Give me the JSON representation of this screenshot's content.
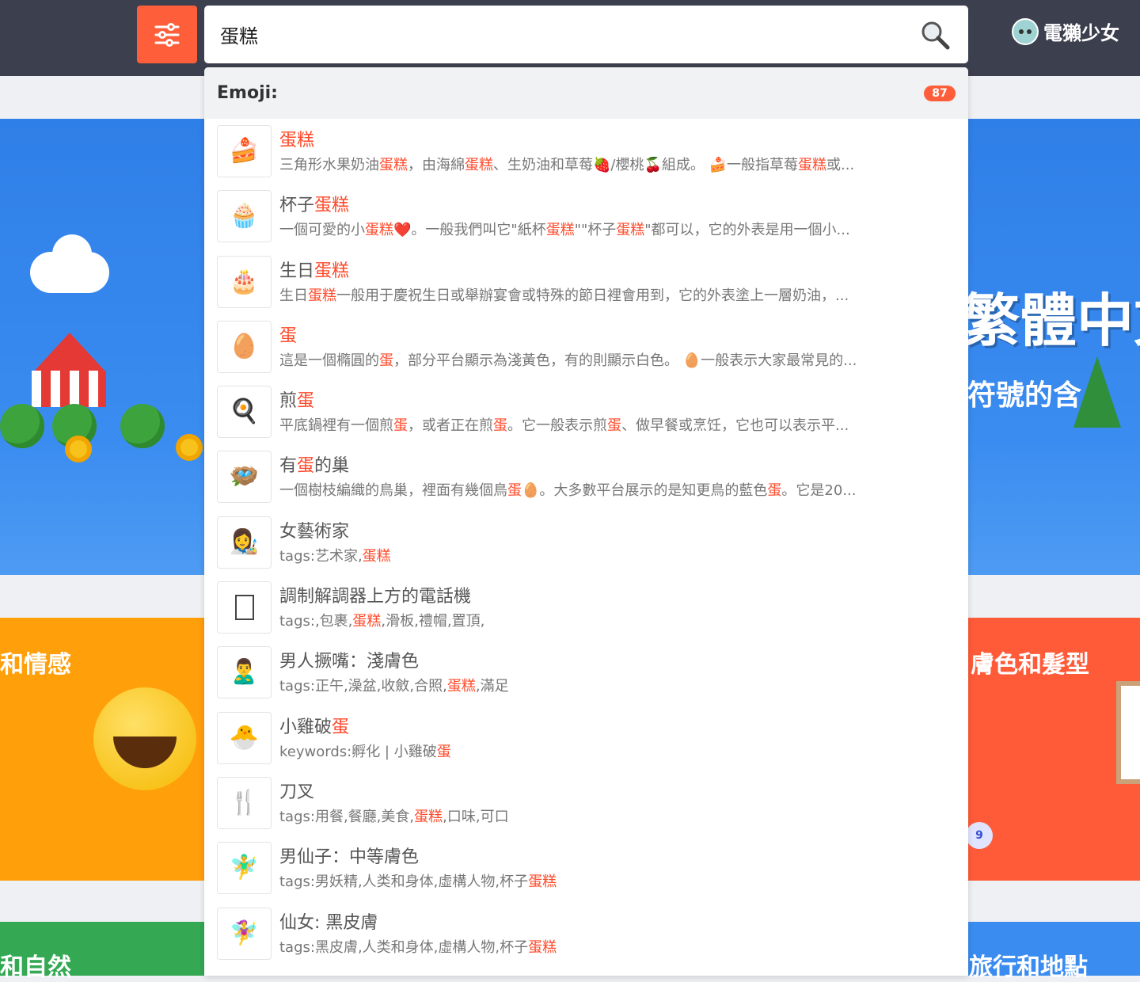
{
  "header": {
    "search_value": "蛋糕",
    "logo_text": "電獺少女"
  },
  "background": {
    "banner_text_1": "繁體中文",
    "banner_text_2": "符號的含",
    "left_card_1": "和情感",
    "right_card_1": "膚色和髮型",
    "left_card_2": "和自然",
    "right_card_2": "旅行和地點",
    "page_badge": "9"
  },
  "dropdown": {
    "section_title": "Emoji:",
    "count": "87",
    "items": [
      {
        "icon": "shortcake-icon",
        "title": [
          {
            "t": "蛋糕",
            "h": true
          }
        ],
        "desc": [
          {
            "t": "三角形水果奶油"
          },
          {
            "t": "蛋糕",
            "h": true
          },
          {
            "t": "，由海綿"
          },
          {
            "t": "蛋糕",
            "h": true
          },
          {
            "t": "、生奶油和草莓🍓/櫻桃🍒組成。 🍰一般指草莓"
          },
          {
            "t": "蛋糕",
            "h": true
          },
          {
            "t": "或..."
          }
        ]
      },
      {
        "icon": "cupcake-icon",
        "title": [
          {
            "t": "杯子"
          },
          {
            "t": "蛋糕",
            "h": true
          }
        ],
        "desc": [
          {
            "t": "一個可愛的小"
          },
          {
            "t": "蛋糕",
            "h": true
          },
          {
            "t": "❤️。一般我們叫它\"紙杯"
          },
          {
            "t": "蛋糕",
            "h": true
          },
          {
            "t": "\"\"杯子"
          },
          {
            "t": "蛋糕",
            "h": true
          },
          {
            "t": "\"都可以，它的外表是用一個小..."
          }
        ]
      },
      {
        "icon": "birthday-cake-icon",
        "title": [
          {
            "t": "生日"
          },
          {
            "t": "蛋糕",
            "h": true
          }
        ],
        "desc": [
          {
            "t": "生日"
          },
          {
            "t": "蛋糕",
            "h": true
          },
          {
            "t": "一般用于慶祝生日或舉辦宴會或特殊的節日裡會用到，它的外表塗上一層奶油，..."
          }
        ]
      },
      {
        "icon": "egg-icon",
        "title": [
          {
            "t": "蛋",
            "h": true
          }
        ],
        "desc": [
          {
            "t": "這是一個橢圓的"
          },
          {
            "t": "蛋",
            "h": true
          },
          {
            "t": "，部分平台顯示為淺黃色，有的則顯示白色。 🥚一般表示大家最常見的..."
          }
        ]
      },
      {
        "icon": "frying-pan-icon",
        "title": [
          {
            "t": "煎"
          },
          {
            "t": "蛋",
            "h": true
          }
        ],
        "desc": [
          {
            "t": "平底鍋裡有一個煎"
          },
          {
            "t": "蛋",
            "h": true
          },
          {
            "t": "，或者正在煎"
          },
          {
            "t": "蛋",
            "h": true
          },
          {
            "t": "。它一般表示煎"
          },
          {
            "t": "蛋",
            "h": true
          },
          {
            "t": "、做早餐或烹饪，它也可以表示平..."
          }
        ]
      },
      {
        "icon": "nest-with-eggs-icon",
        "title": [
          {
            "t": "有"
          },
          {
            "t": "蛋",
            "h": true
          },
          {
            "t": "的巢"
          }
        ],
        "desc": [
          {
            "t": "一個樹枝編織的鳥巢，裡面有幾個鳥"
          },
          {
            "t": "蛋",
            "h": true
          },
          {
            "t": "🥚。大多數平台展示的是知更鳥的藍色"
          },
          {
            "t": "蛋",
            "h": true
          },
          {
            "t": "。它是20..."
          }
        ]
      },
      {
        "icon": "woman-artist-icon",
        "title": [
          {
            "t": "女藝術家"
          }
        ],
        "desc": [
          {
            "t": "tags:艺术家,"
          },
          {
            "t": "蛋糕",
            "h": true
          }
        ]
      },
      {
        "icon": "missing-glyph-icon",
        "title": [
          {
            "t": "調制解調器上方的電話機"
          }
        ],
        "desc": [
          {
            "t": "tags:,包裹,"
          },
          {
            "t": "蛋糕",
            "h": true
          },
          {
            "t": ",滑板,禮帽,置頂,"
          }
        ]
      },
      {
        "icon": "man-pouting-icon",
        "title": [
          {
            "t": "男人撅嘴：淺膚色"
          }
        ],
        "desc": [
          {
            "t": "tags:正午,澡盆,收斂,合照,"
          },
          {
            "t": "蛋糕",
            "h": true
          },
          {
            "t": ",滿足"
          }
        ]
      },
      {
        "icon": "hatching-chick-icon",
        "title": [
          {
            "t": "小雞破"
          },
          {
            "t": "蛋",
            "h": true
          }
        ],
        "desc": [
          {
            "t": "keywords:孵化 | 小雞破"
          },
          {
            "t": "蛋",
            "h": true
          }
        ]
      },
      {
        "icon": "fork-and-knife-icon",
        "title": [
          {
            "t": "刀叉"
          }
        ],
        "desc": [
          {
            "t": "tags:用餐,餐廳,美食,"
          },
          {
            "t": "蛋糕",
            "h": true
          },
          {
            "t": ",口味,可口"
          }
        ]
      },
      {
        "icon": "man-fairy-icon",
        "title": [
          {
            "t": "男仙子：中等膚色"
          }
        ],
        "desc": [
          {
            "t": "tags:男妖精,人类和身体,虛構人物,杯子"
          },
          {
            "t": "蛋糕",
            "h": true
          }
        ]
      },
      {
        "icon": "woman-fairy-icon",
        "title": [
          {
            "t": "仙女: 黑皮膚"
          }
        ],
        "desc": [
          {
            "t": "tags:黑皮膚,人类和身体,虛構人物,杯子"
          },
          {
            "t": "蛋糕",
            "h": true
          }
        ]
      }
    ]
  },
  "colors": {
    "topbar": "#3c3f4e",
    "accent": "#ff5e3a",
    "highlight": "#ff4a2a"
  }
}
